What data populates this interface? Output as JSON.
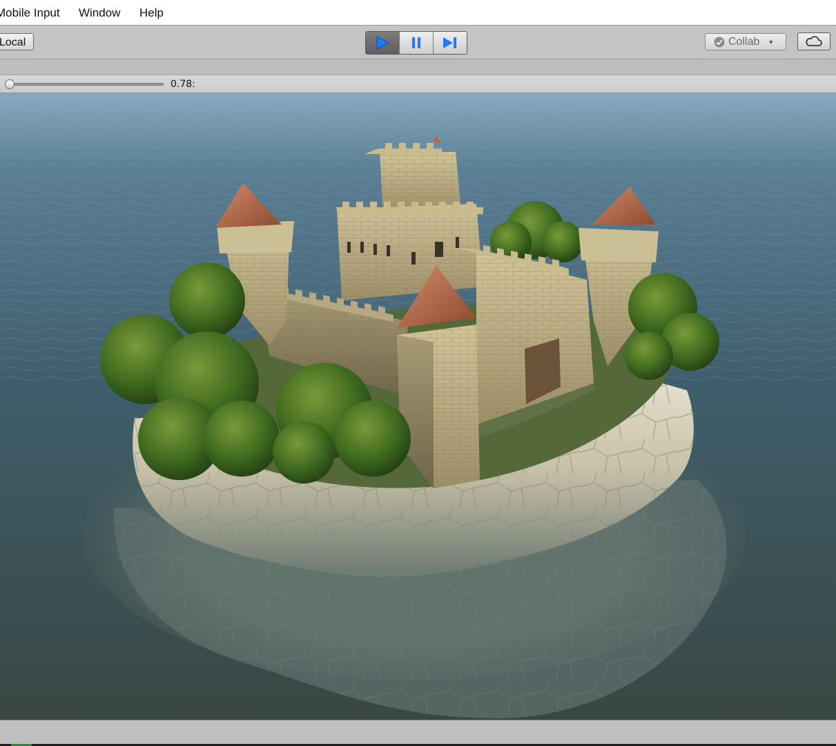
{
  "menu": {
    "items": [
      "Mobile Input",
      "Window",
      "Help"
    ]
  },
  "toolbar": {
    "local_label": "Local",
    "play_icon": "play-icon",
    "pause_icon": "pause-icon",
    "step_icon": "step-icon",
    "collab_label": "Collab",
    "cloud_icon": "cloud-icon",
    "play_active_color": "#1e7bff"
  },
  "game_view": {
    "scale_value": "0.78:",
    "scale_level": 0.0
  },
  "scene": {
    "water_color": "#3f5f6e",
    "stone_color": "#b9ad86",
    "roof_color": "#b5694a",
    "foliage_color": "#3f6a1f"
  }
}
